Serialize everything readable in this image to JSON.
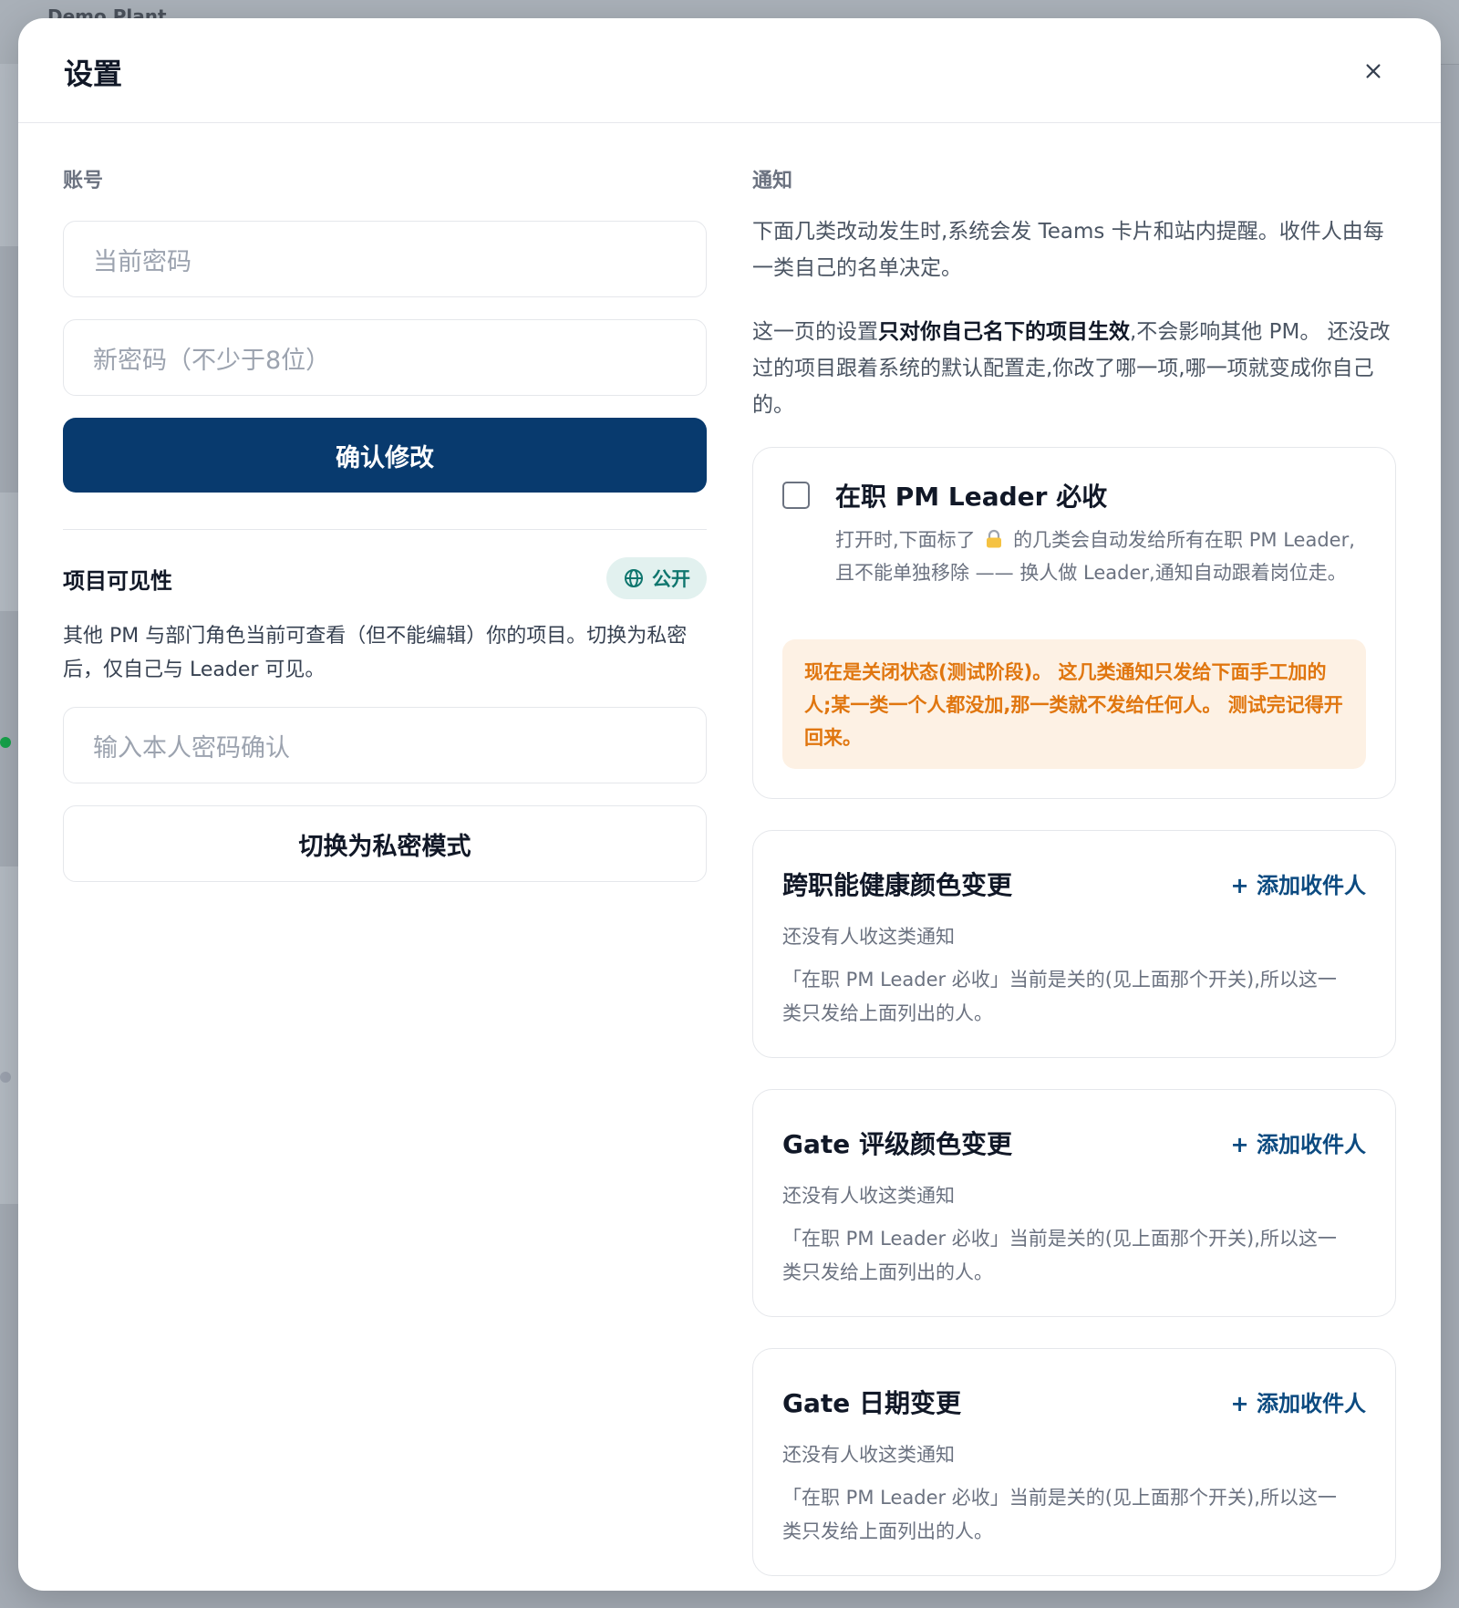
{
  "background": {
    "brand": "Demo Plant"
  },
  "modal": {
    "title": "设置"
  },
  "account": {
    "label": "账号",
    "current_password_placeholder": "当前密码",
    "new_password_placeholder": "新密码（不少于8位）",
    "confirm_button": "确认修改"
  },
  "visibility": {
    "title": "项目可见性",
    "badge": "公开",
    "description": "其他 PM 与部门角色当前可查看（但不能编辑）你的项目。切换为私密后，仅自己与 Leader 可见。",
    "password_placeholder": "输入本人密码确认",
    "toggle_button": "切换为私密模式"
  },
  "notifications": {
    "label": "通知",
    "intro": "下面几类改动发生时,系统会发 Teams 卡片和站内提醒。收件人由每一类自己的名单决定。",
    "scope_prefix": "这一页的设置",
    "scope_bold": "只对你自己名下的项目生效",
    "scope_suffix": ",不会影响其他 PM。 还没改过的项目跟着系统的默认配置走,你改了哪一项,哪一项就变成你自己的。",
    "leader": {
      "title": "在职 PM Leader 必收",
      "desc_before": "打开时,下面标了",
      "desc_after": "的几类会自动发给所有在职 PM Leader,且不能单独移除 —— 换人做 Leader,通知自动跟着岗位走。",
      "warning_pre": "现在是关闭状态(测试阶段)。 这几类通知只发给下面手工加的人;",
      "warning_bold": "某一类一个人都没加,那一类就不发给任何人",
      "warning_post": "。 测试完记得开回来。"
    },
    "categories": [
      {
        "title": "跨职能健康颜色变更",
        "add_label": "+ 添加收件人",
        "empty": "还没有人收这类通知",
        "note": "「在职 PM Leader 必收」当前是关的(见上面那个开关),所以这一类只发给上面列出的人。"
      },
      {
        "title": "Gate 评级颜色变更",
        "add_label": "+ 添加收件人",
        "empty": "还没有人收这类通知",
        "note": "「在职 PM Leader 必收」当前是关的(见上面那个开关),所以这一类只发给上面列出的人。"
      },
      {
        "title": "Gate 日期变更",
        "add_label": "+ 添加收件人",
        "empty": "还没有人收这类通知",
        "note": "「在职 PM Leader 必收」当前是关的(见上面那个开关),所以这一类只发给上面列出的人。"
      }
    ]
  },
  "colors": {
    "primary": "#083a6e",
    "public_badge_bg": "#e2f1ef",
    "public_badge_text": "#0f766e",
    "warning_bg": "#fdf1e4",
    "warning_text": "#e0760f",
    "link": "#0b4a80"
  },
  "icons": {
    "close": "close-icon",
    "globe": "globe-icon",
    "lock": "lock-icon",
    "checkbox": "checkbox-unchecked"
  }
}
